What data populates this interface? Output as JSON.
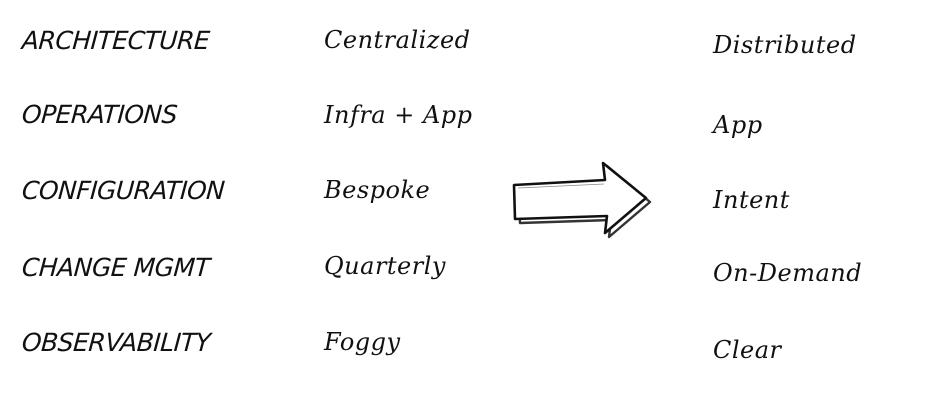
{
  "categories": [
    "ARCHITECTURE",
    "OPERATIONS",
    "CONFIGURATION",
    "CHANGE MGMT",
    "OBSERVABILITY"
  ],
  "from": [
    "Centralized",
    "Infra + App",
    "Bespoke",
    "Quarterly",
    "Foggy"
  ],
  "to": [
    "Distributed",
    "App",
    "Intent",
    "On-Demand",
    "Clear"
  ],
  "arrow": {
    "direction": "right",
    "icon": "hand-drawn-arrow-right-icon",
    "stroke_color": "#111111"
  },
  "colors": {
    "ink": "#111111",
    "background": "#ffffff"
  }
}
